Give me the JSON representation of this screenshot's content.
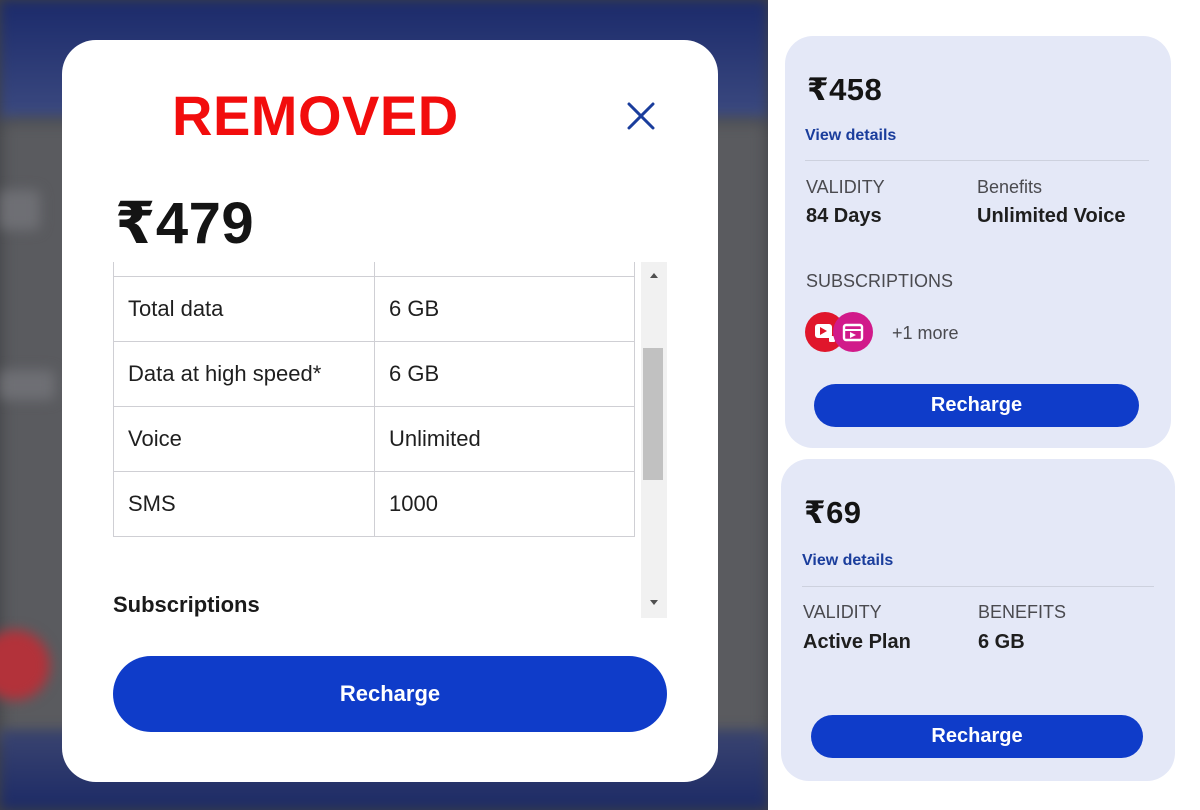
{
  "modal": {
    "title": "REMOVED",
    "price": "₹479",
    "rows": [
      {
        "key": "Total data",
        "value": "6 GB"
      },
      {
        "key": "Data at high speed*",
        "value": "6 GB"
      },
      {
        "key": "Voice",
        "value": "Unlimited"
      },
      {
        "key": "SMS",
        "value": "1000"
      }
    ],
    "subscriptions_heading": "Subscriptions",
    "recharge_label": "Recharge",
    "close_icon": "close-icon"
  },
  "cards": [
    {
      "price": "₹458",
      "view_details": "View details",
      "validity_label": "VALIDITY",
      "validity_value": "84 Days",
      "benefits_label": "Benefits",
      "benefits_value": "Unlimited Voice",
      "subscriptions_label": "SUBSCRIPTIONS",
      "more_text": "+1 more",
      "recharge_label": "Recharge"
    },
    {
      "price": "₹69",
      "view_details": "View details",
      "validity_label": "VALIDITY",
      "validity_value": "Active Plan",
      "benefits_label": "BENEFITS",
      "benefits_value": "6 GB",
      "recharge_label": "Recharge"
    }
  ],
  "colors": {
    "accent": "#0f3cc9",
    "title_red": "#f20d0d",
    "card_bg": "#e4e8f7",
    "link": "#1a3d9c"
  }
}
